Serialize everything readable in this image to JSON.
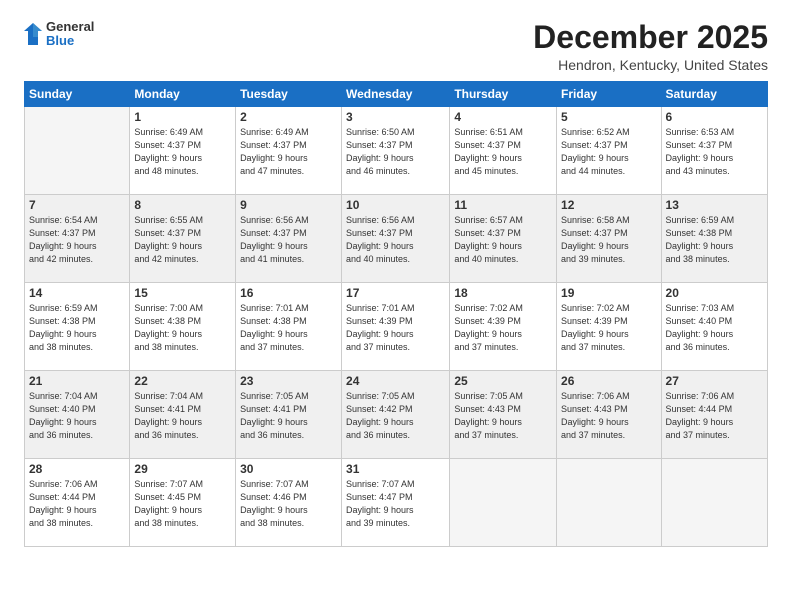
{
  "logo": {
    "general": "General",
    "blue": "Blue"
  },
  "title": "December 2025",
  "location": "Hendron, Kentucky, United States",
  "days_header": [
    "Sunday",
    "Monday",
    "Tuesday",
    "Wednesday",
    "Thursday",
    "Friday",
    "Saturday"
  ],
  "weeks": [
    [
      {
        "num": "",
        "empty": true
      },
      {
        "num": "1",
        "sunrise": "Sunrise: 6:49 AM",
        "sunset": "Sunset: 4:37 PM",
        "daylight": "Daylight: 9 hours and 48 minutes."
      },
      {
        "num": "2",
        "sunrise": "Sunrise: 6:49 AM",
        "sunset": "Sunset: 4:37 PM",
        "daylight": "Daylight: 9 hours and 47 minutes."
      },
      {
        "num": "3",
        "sunrise": "Sunrise: 6:50 AM",
        "sunset": "Sunset: 4:37 PM",
        "daylight": "Daylight: 9 hours and 46 minutes."
      },
      {
        "num": "4",
        "sunrise": "Sunrise: 6:51 AM",
        "sunset": "Sunset: 4:37 PM",
        "daylight": "Daylight: 9 hours and 45 minutes."
      },
      {
        "num": "5",
        "sunrise": "Sunrise: 6:52 AM",
        "sunset": "Sunset: 4:37 PM",
        "daylight": "Daylight: 9 hours and 44 minutes."
      },
      {
        "num": "6",
        "sunrise": "Sunrise: 6:53 AM",
        "sunset": "Sunset: 4:37 PM",
        "daylight": "Daylight: 9 hours and 43 minutes."
      }
    ],
    [
      {
        "num": "7",
        "sunrise": "Sunrise: 6:54 AM",
        "sunset": "Sunset: 4:37 PM",
        "daylight": "Daylight: 9 hours and 42 minutes."
      },
      {
        "num": "8",
        "sunrise": "Sunrise: 6:55 AM",
        "sunset": "Sunset: 4:37 PM",
        "daylight": "Daylight: 9 hours and 42 minutes."
      },
      {
        "num": "9",
        "sunrise": "Sunrise: 6:56 AM",
        "sunset": "Sunset: 4:37 PM",
        "daylight": "Daylight: 9 hours and 41 minutes."
      },
      {
        "num": "10",
        "sunrise": "Sunrise: 6:56 AM",
        "sunset": "Sunset: 4:37 PM",
        "daylight": "Daylight: 9 hours and 40 minutes."
      },
      {
        "num": "11",
        "sunrise": "Sunrise: 6:57 AM",
        "sunset": "Sunset: 4:37 PM",
        "daylight": "Daylight: 9 hours and 40 minutes."
      },
      {
        "num": "12",
        "sunrise": "Sunrise: 6:58 AM",
        "sunset": "Sunset: 4:37 PM",
        "daylight": "Daylight: 9 hours and 39 minutes."
      },
      {
        "num": "13",
        "sunrise": "Sunrise: 6:59 AM",
        "sunset": "Sunset: 4:38 PM",
        "daylight": "Daylight: 9 hours and 38 minutes."
      }
    ],
    [
      {
        "num": "14",
        "sunrise": "Sunrise: 6:59 AM",
        "sunset": "Sunset: 4:38 PM",
        "daylight": "Daylight: 9 hours and 38 minutes."
      },
      {
        "num": "15",
        "sunrise": "Sunrise: 7:00 AM",
        "sunset": "Sunset: 4:38 PM",
        "daylight": "Daylight: 9 hours and 38 minutes."
      },
      {
        "num": "16",
        "sunrise": "Sunrise: 7:01 AM",
        "sunset": "Sunset: 4:38 PM",
        "daylight": "Daylight: 9 hours and 37 minutes."
      },
      {
        "num": "17",
        "sunrise": "Sunrise: 7:01 AM",
        "sunset": "Sunset: 4:39 PM",
        "daylight": "Daylight: 9 hours and 37 minutes."
      },
      {
        "num": "18",
        "sunrise": "Sunrise: 7:02 AM",
        "sunset": "Sunset: 4:39 PM",
        "daylight": "Daylight: 9 hours and 37 minutes."
      },
      {
        "num": "19",
        "sunrise": "Sunrise: 7:02 AM",
        "sunset": "Sunset: 4:39 PM",
        "daylight": "Daylight: 9 hours and 37 minutes."
      },
      {
        "num": "20",
        "sunrise": "Sunrise: 7:03 AM",
        "sunset": "Sunset: 4:40 PM",
        "daylight": "Daylight: 9 hours and 36 minutes."
      }
    ],
    [
      {
        "num": "21",
        "sunrise": "Sunrise: 7:04 AM",
        "sunset": "Sunset: 4:40 PM",
        "daylight": "Daylight: 9 hours and 36 minutes."
      },
      {
        "num": "22",
        "sunrise": "Sunrise: 7:04 AM",
        "sunset": "Sunset: 4:41 PM",
        "daylight": "Daylight: 9 hours and 36 minutes."
      },
      {
        "num": "23",
        "sunrise": "Sunrise: 7:05 AM",
        "sunset": "Sunset: 4:41 PM",
        "daylight": "Daylight: 9 hours and 36 minutes."
      },
      {
        "num": "24",
        "sunrise": "Sunrise: 7:05 AM",
        "sunset": "Sunset: 4:42 PM",
        "daylight": "Daylight: 9 hours and 36 minutes."
      },
      {
        "num": "25",
        "sunrise": "Sunrise: 7:05 AM",
        "sunset": "Sunset: 4:43 PM",
        "daylight": "Daylight: 9 hours and 37 minutes."
      },
      {
        "num": "26",
        "sunrise": "Sunrise: 7:06 AM",
        "sunset": "Sunset: 4:43 PM",
        "daylight": "Daylight: 9 hours and 37 minutes."
      },
      {
        "num": "27",
        "sunrise": "Sunrise: 7:06 AM",
        "sunset": "Sunset: 4:44 PM",
        "daylight": "Daylight: 9 hours and 37 minutes."
      }
    ],
    [
      {
        "num": "28",
        "sunrise": "Sunrise: 7:06 AM",
        "sunset": "Sunset: 4:44 PM",
        "daylight": "Daylight: 9 hours and 38 minutes."
      },
      {
        "num": "29",
        "sunrise": "Sunrise: 7:07 AM",
        "sunset": "Sunset: 4:45 PM",
        "daylight": "Daylight: 9 hours and 38 minutes."
      },
      {
        "num": "30",
        "sunrise": "Sunrise: 7:07 AM",
        "sunset": "Sunset: 4:46 PM",
        "daylight": "Daylight: 9 hours and 38 minutes."
      },
      {
        "num": "31",
        "sunrise": "Sunrise: 7:07 AM",
        "sunset": "Sunset: 4:47 PM",
        "daylight": "Daylight: 9 hours and 39 minutes."
      },
      {
        "num": "",
        "empty": true
      },
      {
        "num": "",
        "empty": true
      },
      {
        "num": "",
        "empty": true
      }
    ]
  ]
}
